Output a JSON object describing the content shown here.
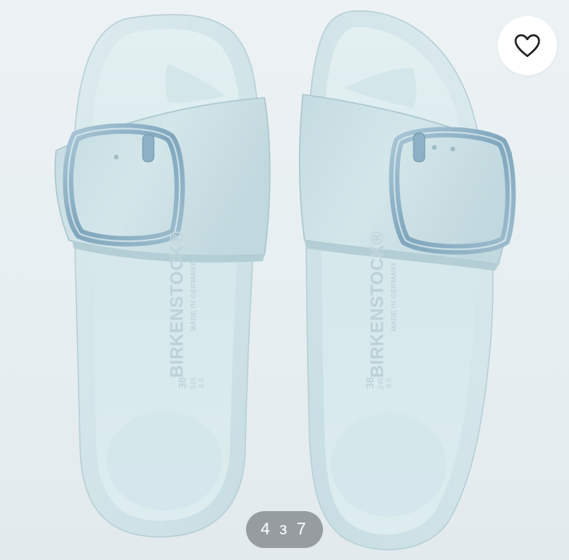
{
  "image": {
    "alt": "BIRKENSTOCK",
    "brand_mark": "BIRKENSTOCK®",
    "origin_mark": "MADE IN GERMANY",
    "size_mark": "38",
    "size_sub_a": "245",
    "size_sub_b": "8.5"
  },
  "favorite": {
    "icon": "heart-icon"
  },
  "pager": {
    "text": "4 з 7"
  },
  "colors": {
    "background": "#eaf0f2",
    "sandal_body": "#d4e6ea",
    "sandal_shadow": "#b9d1d7",
    "strap": "#c9dfe4",
    "buckle": "#8fb3c7"
  }
}
